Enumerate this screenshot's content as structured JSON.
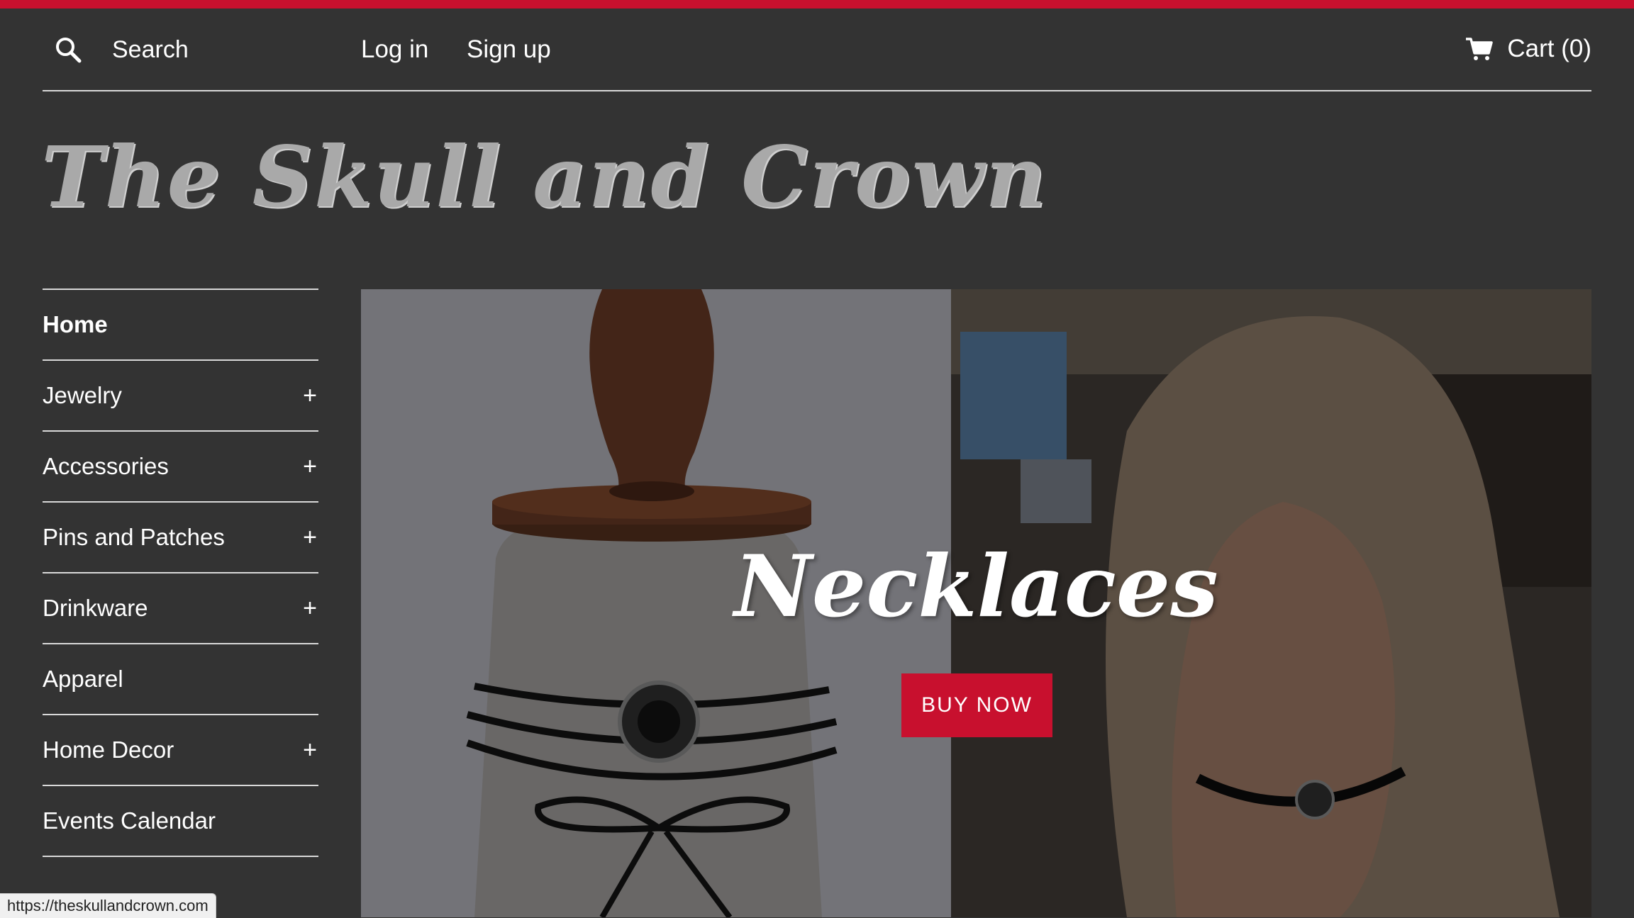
{
  "colors": {
    "accent": "#c8102e",
    "background": "#333333",
    "divider": "#d9d9d9"
  },
  "header": {
    "search_label": "Search",
    "login": "Log in",
    "signup": "Sign up",
    "cart": "Cart (0)"
  },
  "logo_text": "The Skull and Crown",
  "sidebar": {
    "items": [
      {
        "label": "Home",
        "expand": ""
      },
      {
        "label": "Jewelry",
        "expand": "+"
      },
      {
        "label": "Accessories",
        "expand": "+"
      },
      {
        "label": "Pins and Patches",
        "expand": "+"
      },
      {
        "label": "Drinkware",
        "expand": "+"
      },
      {
        "label": "Apparel",
        "expand": ""
      },
      {
        "label": "Home Decor",
        "expand": "+"
      },
      {
        "label": "Events Calendar",
        "expand": ""
      }
    ]
  },
  "hero": {
    "title": "Necklaces",
    "button": "BUY NOW"
  },
  "status_bar": {
    "url": "https://theskullandcrown.com"
  }
}
